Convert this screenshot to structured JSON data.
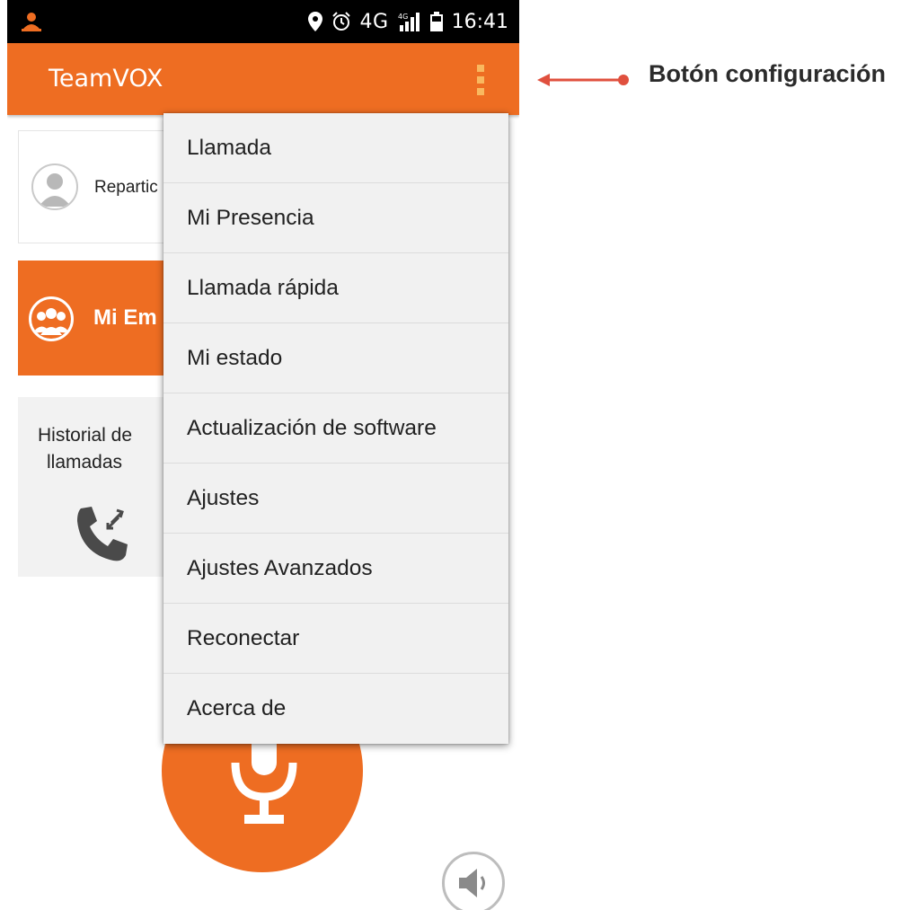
{
  "status_bar": {
    "network": "4G",
    "network_small": "4G",
    "time": "16:41"
  },
  "app_bar": {
    "title": "TeamVOX",
    "overflow_icon": "more-vert-icon"
  },
  "contact": {
    "name": "Repartic"
  },
  "team": {
    "name": "Mi Em"
  },
  "history": {
    "line1": "Historial de",
    "line2": "llamadas"
  },
  "menu": {
    "items": [
      {
        "label": "Llamada"
      },
      {
        "label": "Mi Presencia"
      },
      {
        "label": "Llamada rápida"
      },
      {
        "label": "Mi estado"
      },
      {
        "label": "Actualización de software"
      },
      {
        "label": "Ajustes"
      },
      {
        "label": "Ajustes Avanzados"
      },
      {
        "label": "Reconectar"
      },
      {
        "label": "Acerca de"
      }
    ]
  },
  "annotation": {
    "label": "Botón configuración",
    "arrow_color": "#e0503e"
  },
  "colors": {
    "accent": "#ee6d22",
    "status_bar": "#000000",
    "menu_bg": "#f1f1f1"
  }
}
